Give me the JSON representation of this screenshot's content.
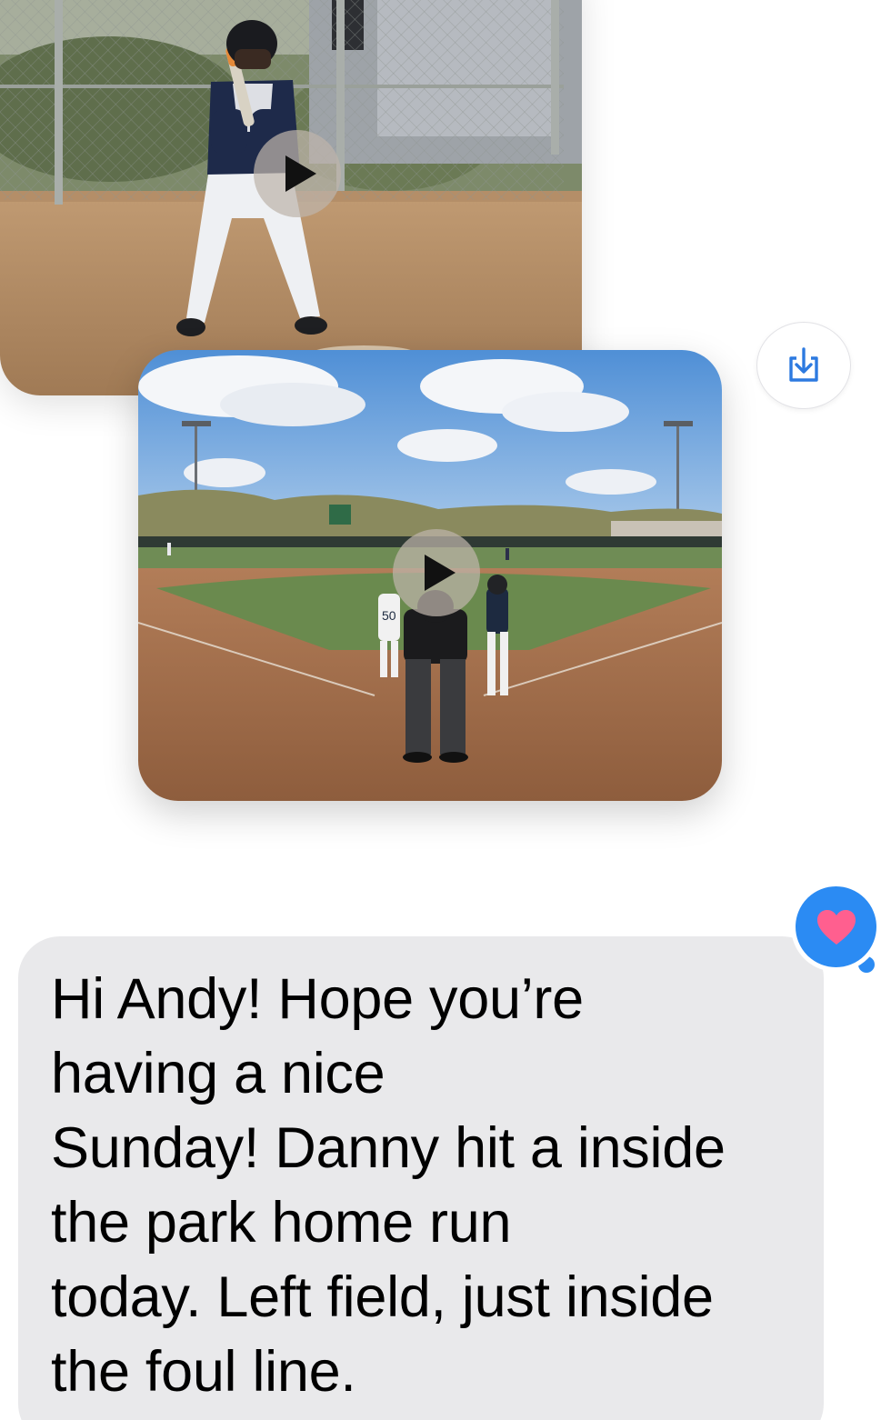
{
  "conversation": {
    "attachments": [
      {
        "type": "video",
        "description_icon": "play-icon",
        "scene": "batter"
      },
      {
        "type": "video",
        "description_icon": "play-icon",
        "scene": "field"
      }
    ],
    "save_button_icon": "download-icon",
    "reaction": {
      "icon": "heart-icon",
      "color": "#2b8bf3",
      "heart_color": "#ff5f8f"
    },
    "incoming_message": {
      "text": "Hi Andy!  Hope you’re\nhaving a nice\nSunday!  Danny hit a inside\nthe park home run\ntoday.  Left field, just inside\nthe foul line.",
      "bubble_color": "#e9e9eb"
    }
  },
  "jersey_number": "50"
}
